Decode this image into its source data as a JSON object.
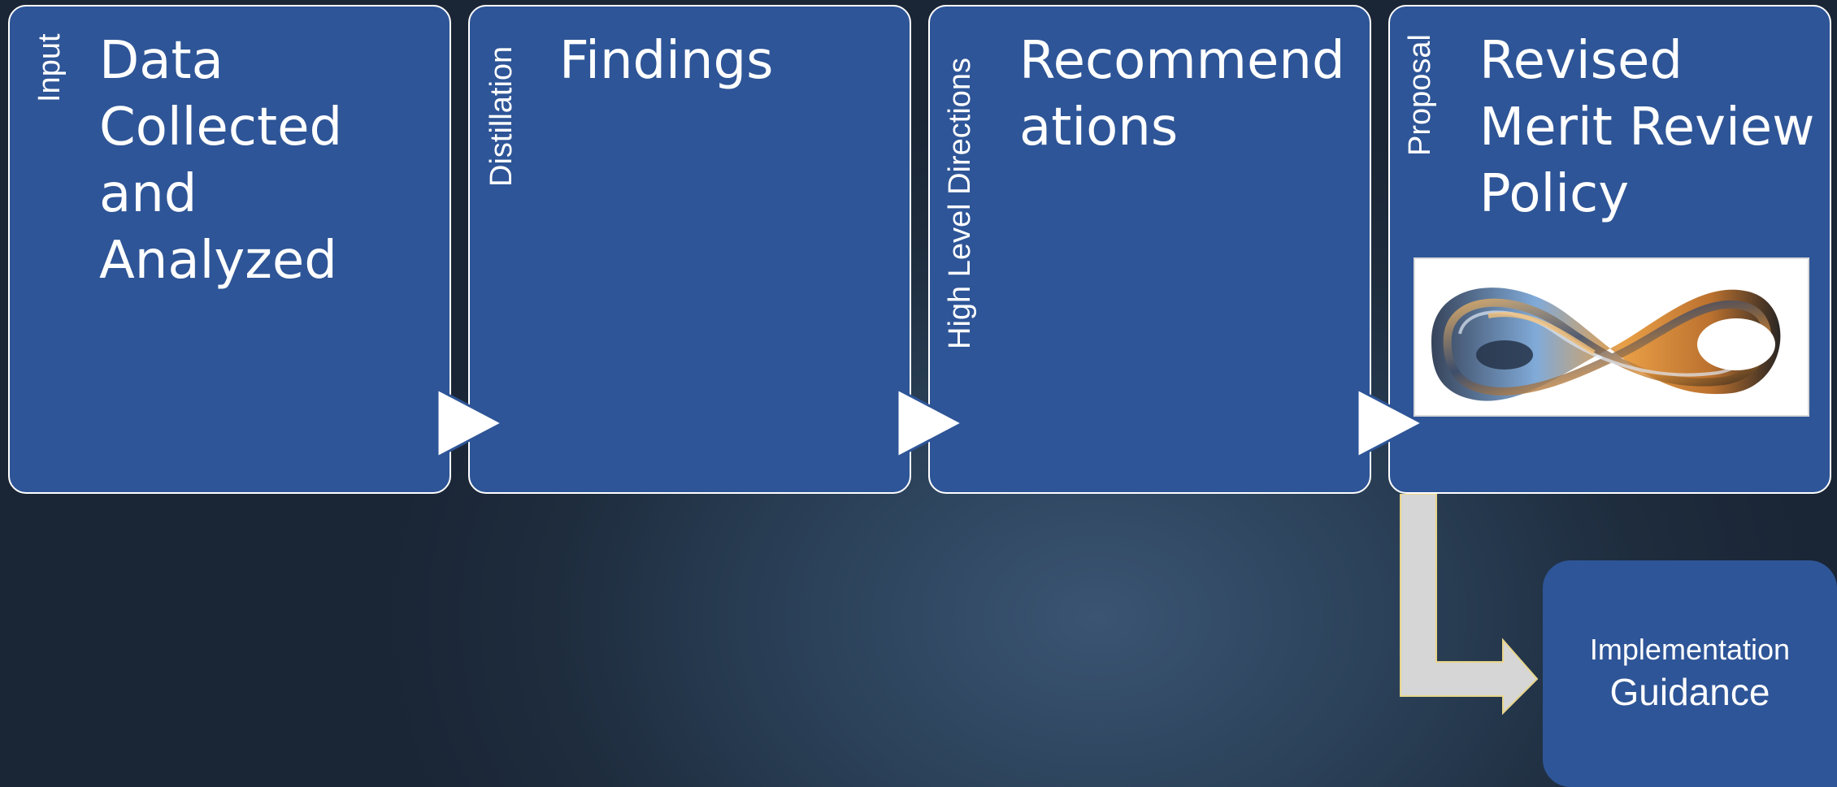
{
  "panels": [
    {
      "side_label": "Input",
      "title": "Data\nCollected\nand Analyzed"
    },
    {
      "side_label": "Distillation",
      "title": "Findings"
    },
    {
      "side_label": "High Level Directions",
      "title": "Recommend\nations"
    },
    {
      "side_label": "Proposal",
      "title": "Revised\nMerit Review\nPolicy"
    }
  ],
  "implementation": {
    "line1": "Implementation",
    "line2": "Guidance"
  },
  "colors": {
    "panel": "#2e5597",
    "border": "#ffffff",
    "connector": "#d6d6d6"
  },
  "icons": {
    "image": "mobius-infinity-image",
    "flow_arrow": "triangle-right-icon",
    "bent_arrow": "bent-down-right-arrow-icon"
  }
}
